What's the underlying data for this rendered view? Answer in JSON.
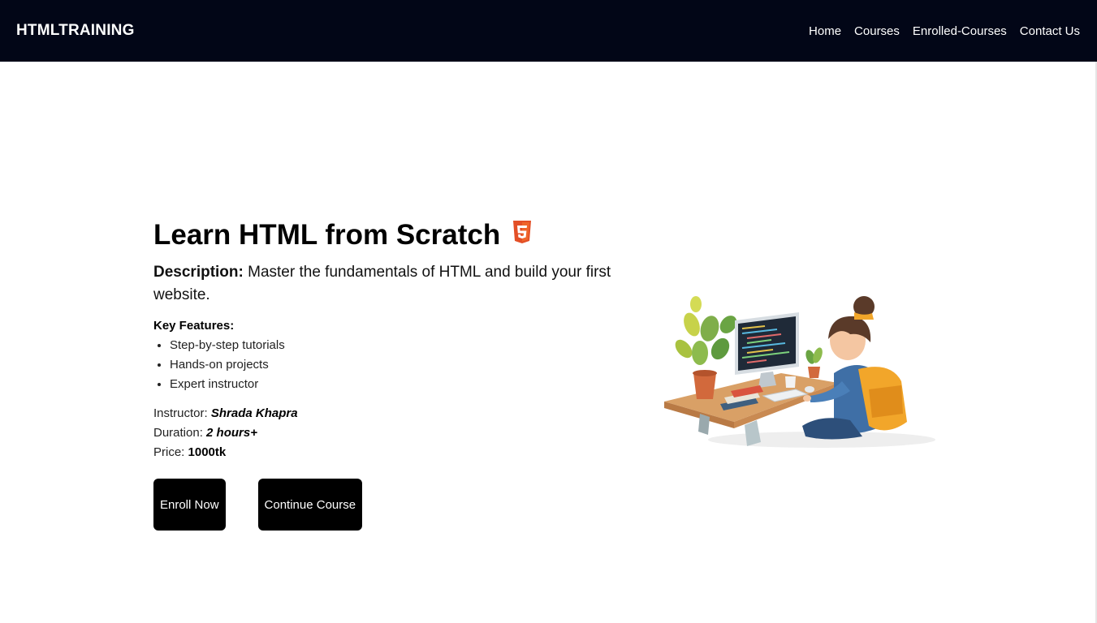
{
  "navbar": {
    "brand": "HTMLTRAINING",
    "links": [
      "Home",
      "Courses",
      "Enrolled-Courses",
      "Contact Us"
    ]
  },
  "course": {
    "title": "Learn HTML from Scratch",
    "title_icon": "html5-icon",
    "description_label": "Description:",
    "description_text": " Master the fundamentals of HTML and build your first website.",
    "features_heading": "Key Features:",
    "features": [
      "Step-by-step tutorials",
      "Hands-on projects",
      "Expert instructor"
    ],
    "instructor_label": "Instructor: ",
    "instructor": "Shrada Khapra",
    "duration_label": "Duration: ",
    "duration": "2 hours+",
    "price_label": "Price: ",
    "price": "1000tk"
  },
  "buttons": {
    "enroll": "Enroll Now",
    "continue": "Continue Course"
  },
  "colors": {
    "navbar_bg": "#020617",
    "button_bg": "#000000",
    "html5_orange": "#E34F26"
  }
}
